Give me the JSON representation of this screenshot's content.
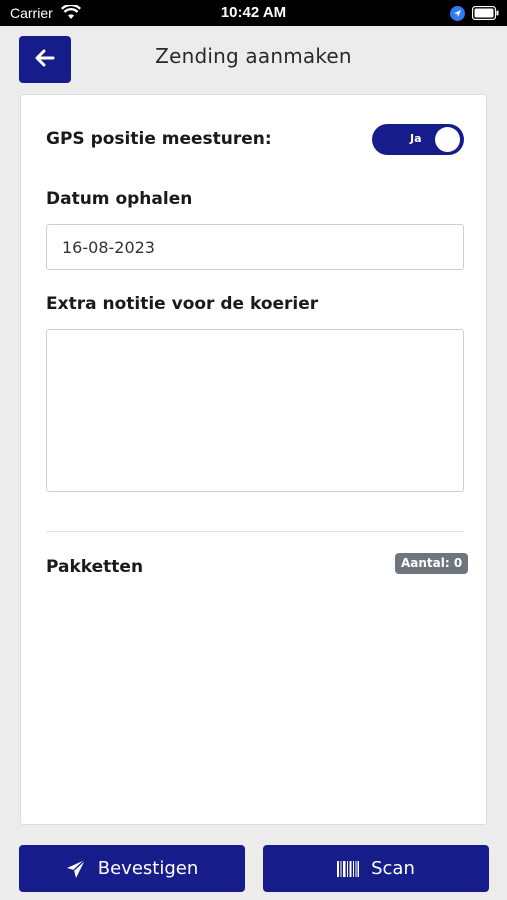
{
  "status_bar": {
    "carrier": "Carrier",
    "time": "10:42 AM"
  },
  "header": {
    "title": "Zending aanmaken",
    "back_icon": "arrow-left-icon"
  },
  "form": {
    "gps_label": "GPS positie meesturen:",
    "gps_toggle_label": "Ja",
    "gps_enabled": true,
    "date_label": "Datum ophalen",
    "date_value": "16-08-2023",
    "note_label": "Extra notitie voor de koerier",
    "note_value": "",
    "packages_label": "Pakketten",
    "packages_count": "Aantal: 0"
  },
  "actions": {
    "confirm_label": "Bevestigen",
    "confirm_icon": "paper-plane-icon",
    "scan_label": "Scan",
    "scan_icon": "barcode-icon"
  },
  "colors": {
    "primary": "#161d8a",
    "badge": "#6e757c",
    "background": "#ececec"
  }
}
